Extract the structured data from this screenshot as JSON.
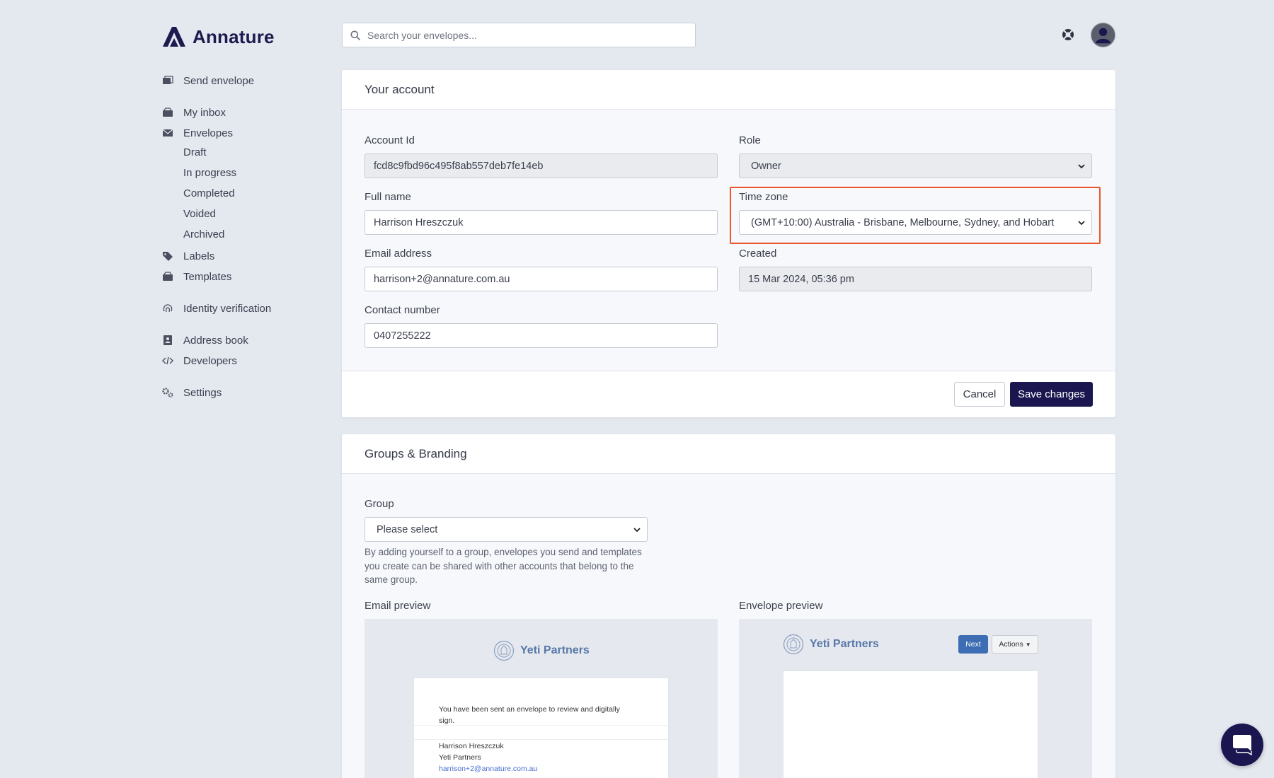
{
  "brand": {
    "name": "Annature",
    "color": "#1d1a4f"
  },
  "search": {
    "placeholder": "Search your envelopes..."
  },
  "sidebar": {
    "send_envelope": "Send envelope",
    "my_inbox": "My inbox",
    "envelopes": "Envelopes",
    "envelope_subitems": [
      "Draft",
      "In progress",
      "Completed",
      "Voided",
      "Archived"
    ],
    "labels": "Labels",
    "templates": "Templates",
    "identity_verification": "Identity verification",
    "address_book": "Address book",
    "developers": "Developers",
    "settings": "Settings"
  },
  "account": {
    "title": "Your account",
    "account_id_label": "Account Id",
    "account_id": "fcd8c9fbd96c495f8ab557deb7fe14eb",
    "role_label": "Role",
    "role": "Owner",
    "full_name_label": "Full name",
    "full_name": "Harrison Hreszczuk",
    "timezone_label": "Time zone",
    "timezone": "(GMT+10:00) Australia - Brisbane, Melbourne, Sydney, and Hobart",
    "email_label": "Email address",
    "email": "harrison+2@annature.com.au",
    "created_label": "Created",
    "created": "15 Mar 2024, 05:36 pm",
    "contact_label": "Contact number",
    "contact": "0407255222",
    "cancel_label": "Cancel",
    "save_label": "Save changes"
  },
  "groups": {
    "title": "Groups & Branding",
    "group_label": "Group",
    "group_value": "Please select",
    "help_text": "By adding yourself to a group, envelopes you send and templates you create can be shared with other accounts that belong to the same group.",
    "email_preview_label": "Email preview",
    "envelope_preview_label": "Envelope preview",
    "brand_name": "Yeti Partners",
    "email_message": "You have been sent an envelope to review and digitally sign.",
    "sig_name": "Harrison Hreszczuk",
    "sig_company": "Yeti Partners",
    "sig_email": "harrison+2@annature.com.au",
    "next_label": "Next",
    "actions_label": "Actions"
  },
  "colors": {
    "primary": "#1b1650",
    "highlight": "#e8562a",
    "link": "#4a6fd0",
    "preview_brand": "#5878a8"
  }
}
